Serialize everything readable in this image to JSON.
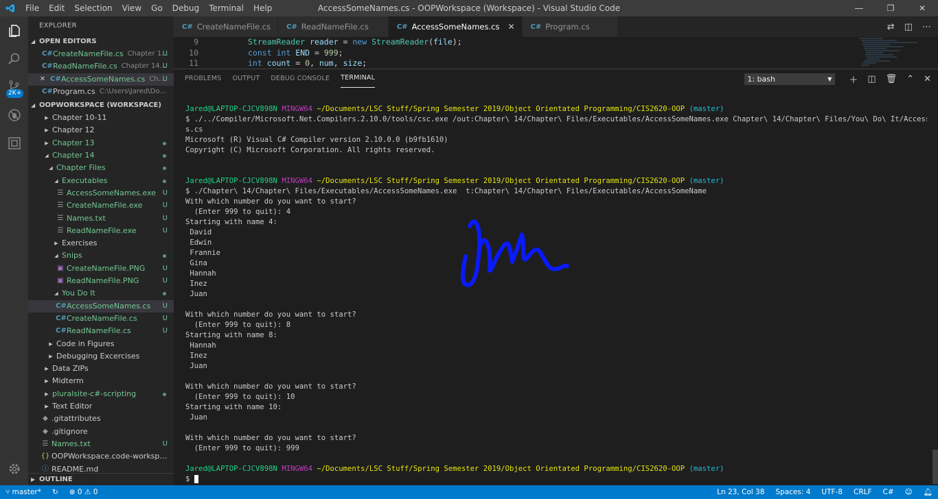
{
  "titlebar": {
    "menu": [
      "File",
      "Edit",
      "Selection",
      "View",
      "Go",
      "Debug",
      "Terminal",
      "Help"
    ],
    "title": "AccessSomeNames.cs - OOPWorkspace (Workspace) - Visual Studio Code"
  },
  "activity": {
    "badge": "2K+"
  },
  "explorer": {
    "title": "EXPLORER",
    "open_editors_label": "OPEN EDITORS",
    "open_editors": [
      {
        "name": "CreateNameFile.cs",
        "desc": "Chapter 1...",
        "status": "U"
      },
      {
        "name": "ReadNameFile.cs",
        "desc": "Chapter 14\\...",
        "status": "U"
      },
      {
        "name": "AccessSomeNames.cs",
        "desc": "Chapt...",
        "status": "U"
      },
      {
        "name": "Program.cs",
        "desc": "C:\\Users\\Jared\\Docum..."
      }
    ],
    "workspace_label": "OOPWORKSPACE (WORKSPACE)",
    "tree": [
      {
        "name": "Chapter 10-11"
      },
      {
        "name": "Chapter 12"
      },
      {
        "name": "Chapter 13"
      },
      {
        "name": "Chapter 14"
      },
      {
        "name": "Chapter Files"
      },
      {
        "name": "Executables"
      },
      {
        "name": "AccessSomeNames.exe",
        "status": "U"
      },
      {
        "name": "CreateNameFile.exe",
        "status": "U"
      },
      {
        "name": "Names.txt",
        "status": "U"
      },
      {
        "name": "ReadNameFile.exe",
        "status": "U"
      },
      {
        "name": "Exercises"
      },
      {
        "name": "Snips"
      },
      {
        "name": "CreateNameFile.PNG",
        "status": "U"
      },
      {
        "name": "ReadNameFile.PNG",
        "status": "U"
      },
      {
        "name": "You Do It"
      },
      {
        "name": "AccessSomeNames.cs",
        "status": "U"
      },
      {
        "name": "CreateNameFile.cs",
        "status": "U"
      },
      {
        "name": "ReadNameFile.cs",
        "status": "U"
      },
      {
        "name": "Code in Figures"
      },
      {
        "name": "Debugging Excercises"
      },
      {
        "name": "Data ZIPs"
      },
      {
        "name": "Midterm"
      },
      {
        "name": "pluralsite-c#-scripting"
      },
      {
        "name": "Text Editor"
      },
      {
        "name": ".gitattributes"
      },
      {
        "name": ".gitignore"
      },
      {
        "name": "Names.txt",
        "status": "U"
      },
      {
        "name": "OOPWorkspace.code-workspace"
      },
      {
        "name": "README.md"
      }
    ],
    "outline_label": "OUTLINE"
  },
  "tabs": [
    {
      "label": "CreateNameFile.cs",
      "icon": "C#"
    },
    {
      "label": "ReadNameFile.cs",
      "icon": "C#"
    },
    {
      "label": "AccessSomeNames.cs",
      "icon": "C#"
    },
    {
      "label": "Program.cs",
      "icon": "C#"
    }
  ],
  "editor": {
    "line_numbers": [
      "9",
      "10",
      "11"
    ]
  },
  "panel": {
    "tabs": [
      "PROBLEMS",
      "OUTPUT",
      "DEBUG CONSOLE",
      "TERMINAL"
    ],
    "terminal_select": "1: bash"
  },
  "terminal": {
    "user_host": "Jared@LAPTOP-CJCV898N",
    "env": "MINGW64",
    "path": "~/Documents/LSC Stuff/Spring Semester 2019/Object Orientated Programming/CIS2620-OOP",
    "branch": "(master)",
    "cmd1a": "$ ./../Compiler/Microsoft.Net.Compilers.2.10.0/tools/csc.exe /out:Chapter\\ 14/Chapter\\ Files/Executables/AccessSomeNames.exe Chapter\\ 14/Chapter\\ Files/You\\ Do\\ It/AccessSomeName",
    "cmd1b": "s.cs",
    "compiler_out": [
      "Microsoft (R) Visual C# Compiler version 2.10.0.0 (b9fb1610)",
      "Copyright (C) Microsoft Corporation. All rights reserved."
    ],
    "cmd2": "$ ./Chapter\\ 14/Chapter\\ Files/Executables/AccessSomeNames.exe  t:Chapter\\ 14/Chapter\\ Files/Executables/AccessSomeName",
    "output": [
      "With which number do you want to start?",
      "  (Enter 999 to quit): 4",
      "Starting with name 4:",
      " David",
      " Edwin",
      " Frannie",
      " Gina",
      " Hannah",
      " Inez",
      " Juan",
      "",
      "With which number do you want to start?",
      "  (Enter 999 to quit): 8",
      "Starting with name 8:",
      " Hannah",
      " Inez",
      " Juan",
      "",
      "With which number do you want to start?",
      "  (Enter 999 to quit): 10",
      "Starting with name 10:",
      " Juan",
      "",
      "With which number do you want to start?",
      "  (Enter 999 to quit): 999"
    ],
    "prompt": "$ "
  },
  "statusbar": {
    "branch": "master*",
    "errors": "0",
    "warnings": "0",
    "position": "Ln 23, Col 38",
    "spaces": "Spaces: 4",
    "encoding": "UTF-8",
    "eol": "CRLF",
    "language": "C#"
  },
  "colors": {
    "accent": "#007acc",
    "signature": "#0a1aff"
  }
}
